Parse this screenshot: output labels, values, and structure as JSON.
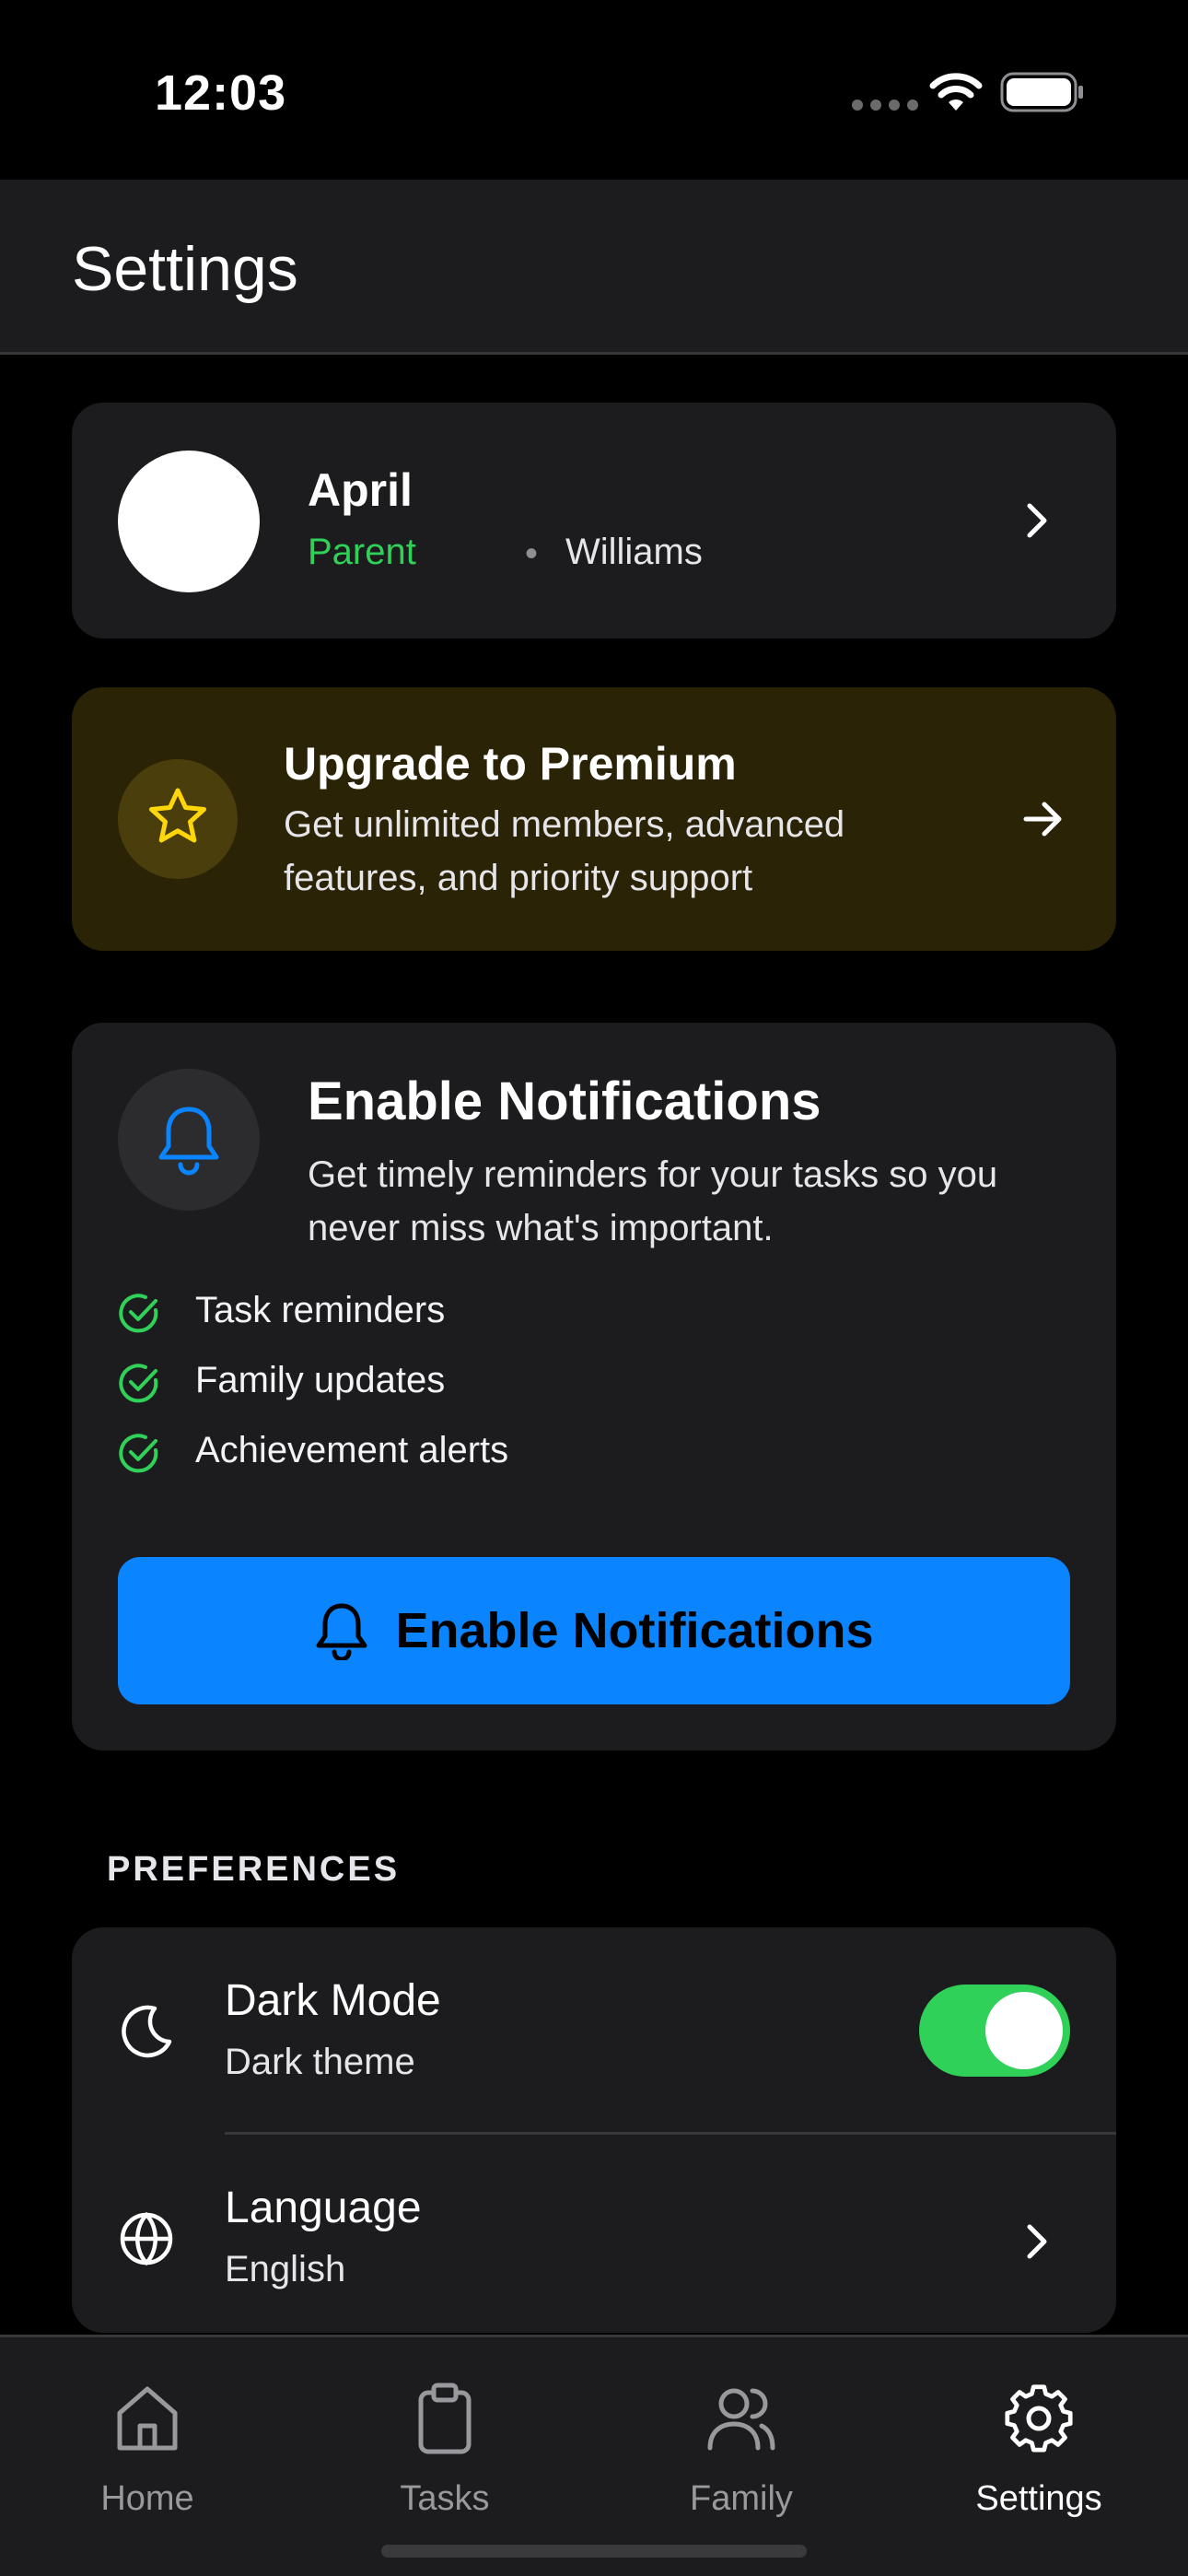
{
  "status_bar": {
    "time": "12:03"
  },
  "header": {
    "title": "Settings"
  },
  "profile": {
    "name": "April",
    "role": "Parent",
    "separator": "•",
    "family": "Williams"
  },
  "premium": {
    "title": "Upgrade to Premium",
    "description": "Get unlimited members, advanced features, and priority support",
    "accent_color": "#ffd60a"
  },
  "notifications": {
    "title": "Enable Notifications",
    "description": "Get timely reminders for your tasks so you never miss what's important.",
    "features": [
      "Task reminders",
      "Family updates",
      "Achievement alerts"
    ],
    "button_label": "Enable Notifications",
    "button_color": "#0a84ff",
    "check_color": "#30d158"
  },
  "preferences": {
    "section_label": "PREFERENCES",
    "dark_mode": {
      "title": "Dark Mode",
      "subtitle": "Dark theme",
      "enabled": true
    },
    "language": {
      "title": "Language",
      "subtitle": "English"
    }
  },
  "tabs": [
    {
      "label": "Home",
      "icon": "home-icon",
      "active": false
    },
    {
      "label": "Tasks",
      "icon": "clipboard-icon",
      "active": false
    },
    {
      "label": "Family",
      "icon": "users-icon",
      "active": false
    },
    {
      "label": "Settings",
      "icon": "gear-icon",
      "active": true
    }
  ]
}
